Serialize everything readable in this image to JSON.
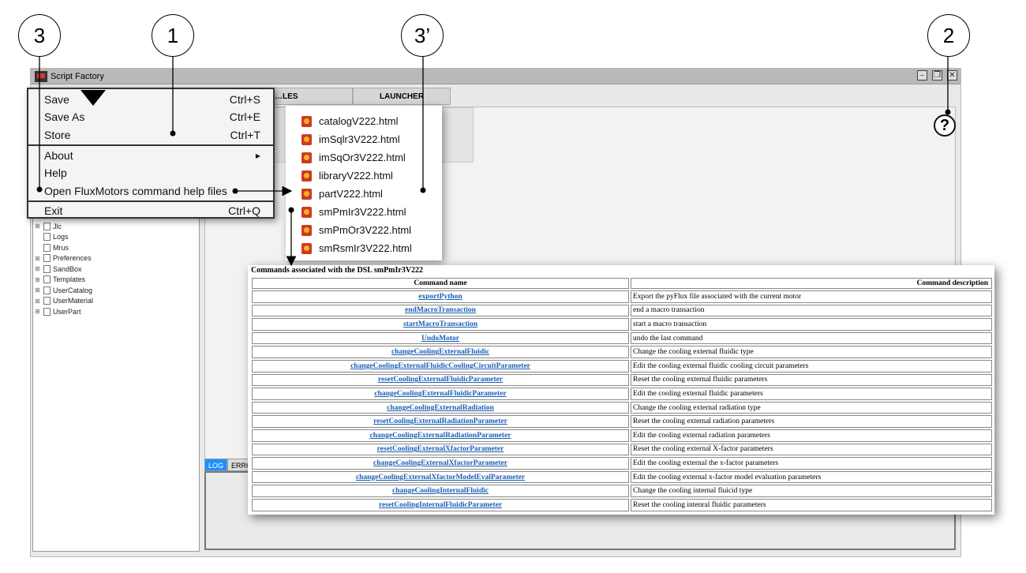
{
  "callouts": {
    "c3": "3",
    "c1": "1",
    "c3p": "3’",
    "c2": "2"
  },
  "window": {
    "title": "Script Factory",
    "controls": {
      "minimize": "–",
      "restore": "❐",
      "close": "✕"
    },
    "tabs": {
      "files": "…LES",
      "launcher": "LAUNCHER"
    },
    "help_icon": "?",
    "log_tabs": {
      "log": "LOG",
      "errors": "ERRO"
    }
  },
  "file_tree": [
    {
      "exp": "⊞",
      "label": "Jlc"
    },
    {
      "exp": "",
      "label": "Logs"
    },
    {
      "exp": "",
      "label": "Mrus"
    },
    {
      "exp": "⊞",
      "label": "Preferences"
    },
    {
      "exp": "⊞",
      "label": "SandBox"
    },
    {
      "exp": "⊞",
      "label": "Templates"
    },
    {
      "exp": "⊞",
      "label": "UserCatalog"
    },
    {
      "exp": "⊞",
      "label": "UserMaterial"
    },
    {
      "exp": "⊞",
      "label": "UserPart"
    }
  ],
  "file_menu": {
    "save": {
      "label": "Save",
      "shortcut": "Ctrl+S"
    },
    "save_as": {
      "label": "Save As",
      "shortcut": "Ctrl+E"
    },
    "store": {
      "label": "Store",
      "shortcut": "Ctrl+T"
    },
    "about": {
      "label": "About"
    },
    "help": {
      "label": "Help"
    },
    "open_help": {
      "label": "Open FluxMotors command help files"
    },
    "exit": {
      "label": "Exit",
      "shortcut": "Ctrl+Q"
    }
  },
  "help_files": [
    "catalogV222.html",
    "imSqlr3V222.html",
    "imSqOr3V222.html",
    "libraryV222.html",
    "partV222.html",
    "smPmIr3V222.html",
    "smPmOr3V222.html",
    "smRsmIr3V222.html"
  ],
  "commands": {
    "caption": "Commands associated with the DSL smPmIr3V222",
    "header_name": "Command name",
    "header_desc": "Command description",
    "rows": [
      {
        "name": "exportPython",
        "desc": "Export the pyFlux file associated with the current motor"
      },
      {
        "name": "endMacroTransaction",
        "desc": "end a macro transaction"
      },
      {
        "name": "startMacroTransaction",
        "desc": "start a macro transaction"
      },
      {
        "name": "UndoMotor",
        "desc": "undo the last command"
      },
      {
        "name": "changeCoolingExternalFluidic",
        "desc": "Change the cooling external fluidic type"
      },
      {
        "name": "changeCoolingExternalFluidicCoolingCircuitParameter",
        "desc": "Edit the cooling external fluidic cooling circuit parameters"
      },
      {
        "name": "resetCoolingExternalFluidicParameter",
        "desc": "Reset the cooling external fluidic parameters"
      },
      {
        "name": "changeCoolingExternalFluidicParameter",
        "desc": "Edit the cooling external fluidic parameters"
      },
      {
        "name": "changeCoolingExternalRadiation",
        "desc": "Change the cooling external radiation type"
      },
      {
        "name": "resetCoolingExternalRadiationParameter",
        "desc": "Reset the cooling external radiation parameters"
      },
      {
        "name": "changeCoolingExternalRadiationParameter",
        "desc": "Edit the cooling external radiation parameters"
      },
      {
        "name": "resetCoolingExternalXfactorParameter",
        "desc": "Reset the cooling external X-factor parameters"
      },
      {
        "name": "changeCoolingExternalXfactorParameter",
        "desc": "Edit the cooling external the x-factor parameters"
      },
      {
        "name": "changeCoolingExternalXfactorModelEvalParameter",
        "desc": "Edit the cooling external x-factor model evaluation parameters"
      },
      {
        "name": "changeCoolingInternalFluidic",
        "desc": "Change the cooling internal fluicid type"
      },
      {
        "name": "resetCoolingInternalFluidicParameter",
        "desc": "Reset the cooling intenral fluidic parameters"
      }
    ]
  }
}
